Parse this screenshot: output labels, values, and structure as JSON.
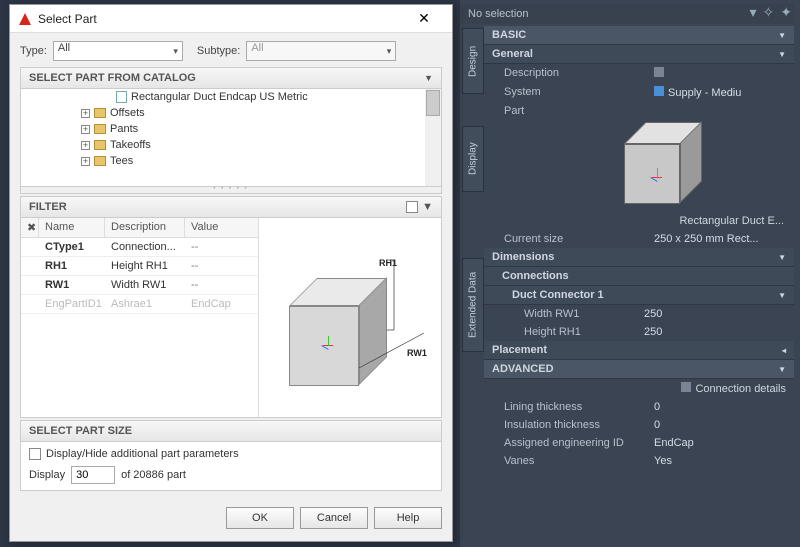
{
  "dialog": {
    "title": "Select Part",
    "type_label": "Type:",
    "type_value": "All",
    "subtype_label": "Subtype:",
    "subtype_value": "All",
    "catalog_header": "SELECT PART FROM CATALOG",
    "tree": {
      "item_doc": "Rectangular Duct Endcap US Metric",
      "folders": [
        "Offsets",
        "Pants",
        "Takeoffs",
        "Tees"
      ]
    },
    "filter_header": "FILTER",
    "filter_cols": {
      "name": "Name",
      "desc": "Description",
      "val": "Value"
    },
    "filter_rows": [
      {
        "name": "CType1",
        "desc": "Connection...",
        "val": "--"
      },
      {
        "name": "RH1",
        "desc": "Height RH1",
        "val": "--"
      },
      {
        "name": "RW1",
        "desc": "Width RW1",
        "val": "--"
      },
      {
        "name": "EngPartID1",
        "desc": "Ashrae1",
        "val": "EndCap",
        "disabled": true
      }
    ],
    "dims": {
      "rh1": "RH1",
      "rw1": "RW1"
    },
    "size_header": "SELECT PART SIZE",
    "toggle_label": "Display/Hide additional part parameters",
    "display_label": "Display",
    "display_value": "30",
    "display_suffix": "of 20886 part",
    "buttons": {
      "ok": "OK",
      "cancel": "Cancel",
      "help": "Help"
    }
  },
  "panel": {
    "no_selection": "No selection",
    "tabs": {
      "design": "Design",
      "display": "Display",
      "ext": "Extended Data"
    },
    "basic": "BASIC",
    "general": "General",
    "desc_label": "Description",
    "system_label": "System",
    "system_value": "Supply - Mediu",
    "part_label": "Part",
    "part_name": "Rectangular Duct E...",
    "current_size_label": "Current size",
    "current_size_value": "250 x 250 mm Rect...",
    "dimensions": "Dimensions",
    "connections": "Connections",
    "duct_connector": "Duct Connector 1",
    "width_label": "Width RW1",
    "width_value": "250",
    "height_label": "Height RH1",
    "height_value": "250",
    "placement": "Placement",
    "advanced": "ADVANCED",
    "conn_details": "Connection details",
    "lining_label": "Lining thickness",
    "lining_value": "0",
    "insul_label": "Insulation thickness",
    "insul_value": "0",
    "eng_id_label": "Assigned engineering ID",
    "eng_id_value": "EndCap",
    "vanes_label": "Vanes",
    "vanes_value": "Yes"
  }
}
